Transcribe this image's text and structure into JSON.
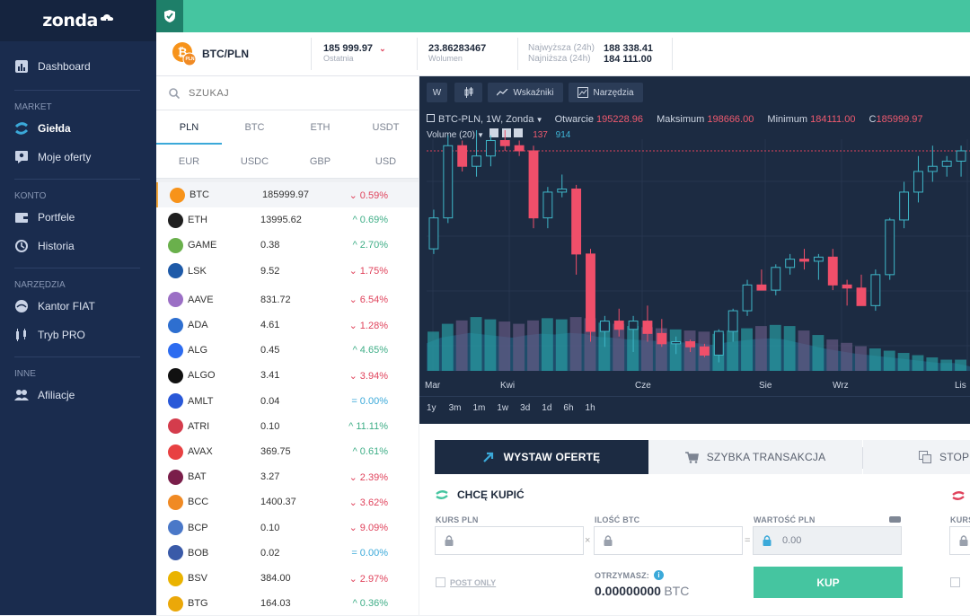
{
  "brand": "zonda",
  "sidebar": {
    "sections": [
      {
        "title": "",
        "items": [
          {
            "label": "Dashboard",
            "icon": "dashboard-icon"
          }
        ]
      },
      {
        "title": "MARKET",
        "items": [
          {
            "label": "Giełda",
            "icon": "exchange-icon",
            "active": true
          },
          {
            "label": "Moje oferty",
            "icon": "offers-icon"
          }
        ]
      },
      {
        "title": "KONTO",
        "items": [
          {
            "label": "Portfele",
            "icon": "wallet-icon"
          },
          {
            "label": "Historia",
            "icon": "history-icon"
          }
        ]
      },
      {
        "title": "NARZĘDZIA",
        "items": [
          {
            "label": "Kantor FIAT",
            "icon": "fiat-icon"
          },
          {
            "label": "Tryb PRO",
            "icon": "pro-icon"
          }
        ]
      },
      {
        "title": "INNE",
        "items": [
          {
            "label": "Afiliacje",
            "icon": "users-icon"
          }
        ]
      }
    ]
  },
  "ticker": {
    "pair": "BTC/PLN",
    "coin_badge": "PLN",
    "last_value": "185 999.97",
    "last_label": "Ostatnia",
    "volume_value": "23.86283467",
    "volume_label": "Wolumen",
    "high_label": "Najwyższa (24h)",
    "high_value": "188 338.41",
    "low_label": "Najniższa (24h)",
    "low_value": "184 111.00"
  },
  "search": {
    "placeholder": "SZUKAJ"
  },
  "quote_tabs": [
    "PLN",
    "BTC",
    "ETH",
    "USDT",
    "EUR",
    "USDC",
    "GBP",
    "USD"
  ],
  "markets": [
    {
      "sym": "BTC",
      "price": "185999.97",
      "chg": "0.59%",
      "dir": "down",
      "color": "#f7931a"
    },
    {
      "sym": "ETH",
      "price": "13995.62",
      "chg": "0.69%",
      "dir": "up",
      "color": "#1f1f1f"
    },
    {
      "sym": "GAME",
      "price": "0.38",
      "chg": "2.70%",
      "dir": "up",
      "color": "#6ab04c"
    },
    {
      "sym": "LSK",
      "price": "9.52",
      "chg": "1.75%",
      "dir": "down",
      "color": "#1e5aa8"
    },
    {
      "sym": "AAVE",
      "price": "831.72",
      "chg": "6.54%",
      "dir": "down",
      "color": "#9b6fc5"
    },
    {
      "sym": "ADA",
      "price": "4.61",
      "chg": "1.28%",
      "dir": "down",
      "color": "#2e6fd0"
    },
    {
      "sym": "ALG",
      "price": "0.45",
      "chg": "4.65%",
      "dir": "up",
      "color": "#2d6cf0"
    },
    {
      "sym": "ALGO",
      "price": "3.41",
      "chg": "3.94%",
      "dir": "down",
      "color": "#111111"
    },
    {
      "sym": "AMLT",
      "price": "0.04",
      "chg": "0.00%",
      "dir": "flat",
      "color": "#2958d8"
    },
    {
      "sym": "ATRI",
      "price": "0.10",
      "chg": "11.11%",
      "dir": "up",
      "color": "#d43c4c"
    },
    {
      "sym": "AVAX",
      "price": "369.75",
      "chg": "0.61%",
      "dir": "up",
      "color": "#e84142"
    },
    {
      "sym": "BAT",
      "price": "3.27",
      "chg": "2.39%",
      "dir": "down",
      "color": "#7a1e4a"
    },
    {
      "sym": "BCC",
      "price": "1400.37",
      "chg": "3.62%",
      "dir": "down",
      "color": "#f08a24"
    },
    {
      "sym": "BCP",
      "price": "0.10",
      "chg": "9.09%",
      "dir": "down",
      "color": "#4a78c8"
    },
    {
      "sym": "BOB",
      "price": "0.02",
      "chg": "0.00%",
      "dir": "flat",
      "color": "#3a5aa8"
    },
    {
      "sym": "BSV",
      "price": "384.00",
      "chg": "2.97%",
      "dir": "down",
      "color": "#eab300"
    },
    {
      "sym": "BTG",
      "price": "164.03",
      "chg": "0.36%",
      "dir": "up",
      "color": "#eba809"
    }
  ],
  "chart_toolbar": {
    "interval": "W",
    "indicators": "Wskaźniki",
    "tools": "Narzędzia"
  },
  "chart_legend": {
    "title": "BTC-PLN, 1W, Zonda",
    "open_label": "Otwarcie",
    "open": "195228.96",
    "high_label": "Maksimum",
    "high": "198666.00",
    "low_label": "Minimum",
    "low": "184111.00",
    "close_label": "C",
    "close": "185999.97",
    "volume_label": "Volume (20)",
    "vol_a": "137",
    "vol_b": "914"
  },
  "chart_xlabels": [
    "Mar",
    "Kwi",
    "Cze",
    "Sie",
    "Wrz",
    "Lis"
  ],
  "ranges": [
    "1y",
    "3m",
    "1m",
    "1w",
    "3d",
    "1d",
    "6h",
    "1h"
  ],
  "chart_data": {
    "type": "candlestick",
    "ohlc": [
      [
        100,
        138,
        95,
        130
      ],
      [
        130,
        210,
        125,
        200
      ],
      [
        200,
        205,
        175,
        180
      ],
      [
        180,
        215,
        170,
        190
      ],
      [
        190,
        210,
        180,
        205
      ],
      [
        205,
        215,
        195,
        200
      ],
      [
        200,
        205,
        190,
        195
      ],
      [
        195,
        200,
        120,
        130
      ],
      [
        130,
        160,
        120,
        155
      ],
      [
        155,
        172,
        150,
        158
      ],
      [
        158,
        162,
        75,
        95
      ],
      [
        95,
        100,
        10,
        20
      ],
      [
        20,
        35,
        5,
        30
      ],
      [
        30,
        42,
        15,
        22
      ],
      [
        22,
        35,
        0,
        30
      ],
      [
        30,
        45,
        10,
        18
      ],
      [
        18,
        32,
        5,
        8
      ],
      [
        8,
        15,
        -2,
        10
      ],
      [
        10,
        12,
        0,
        5
      ],
      [
        5,
        8,
        -5,
        -3
      ],
      [
        -3,
        22,
        -10,
        20
      ],
      [
        20,
        42,
        10,
        40
      ],
      [
        40,
        70,
        35,
        65
      ],
      [
        65,
        80,
        60,
        60
      ],
      [
        60,
        85,
        55,
        82
      ],
      [
        82,
        95,
        75,
        90
      ],
      [
        90,
        100,
        80,
        88
      ],
      [
        88,
        95,
        70,
        92
      ],
      [
        92,
        100,
        60,
        65
      ],
      [
        65,
        70,
        45,
        62
      ],
      [
        62,
        75,
        45,
        45
      ],
      [
        45,
        80,
        40,
        75
      ],
      [
        75,
        130,
        70,
        128
      ],
      [
        128,
        165,
        120,
        155
      ],
      [
        155,
        190,
        145,
        175
      ],
      [
        175,
        200,
        165,
        180
      ],
      [
        180,
        190,
        170,
        185
      ],
      [
        185,
        200,
        170,
        195
      ]
    ],
    "volume": [
      35,
      42,
      45,
      48,
      46,
      44,
      42,
      45,
      47,
      46,
      48,
      47,
      43,
      42,
      40,
      39,
      38,
      37,
      36,
      35,
      33,
      36,
      38,
      40,
      41,
      40,
      36,
      32,
      28,
      25,
      22,
      20,
      18,
      16,
      14,
      12,
      10,
      10
    ]
  },
  "order": {
    "tabs": [
      "WYSTAW OFERTĘ",
      "SZYBKA TRANSAKCJA",
      "STOP"
    ],
    "buy_title": "CHCĘ KUPIĆ",
    "rate_label": "KURS PLN",
    "amount_label": "ILOŚĆ BTC",
    "value_label": "WARTOŚĆ PLN",
    "value_input": "0.00",
    "post_only": "POST ONLY",
    "receive_label": "OTRZYMASZ:",
    "receive_value": "0.00000000",
    "receive_unit": "BTC",
    "buy_button": "KUP",
    "right_label": "KURS"
  }
}
